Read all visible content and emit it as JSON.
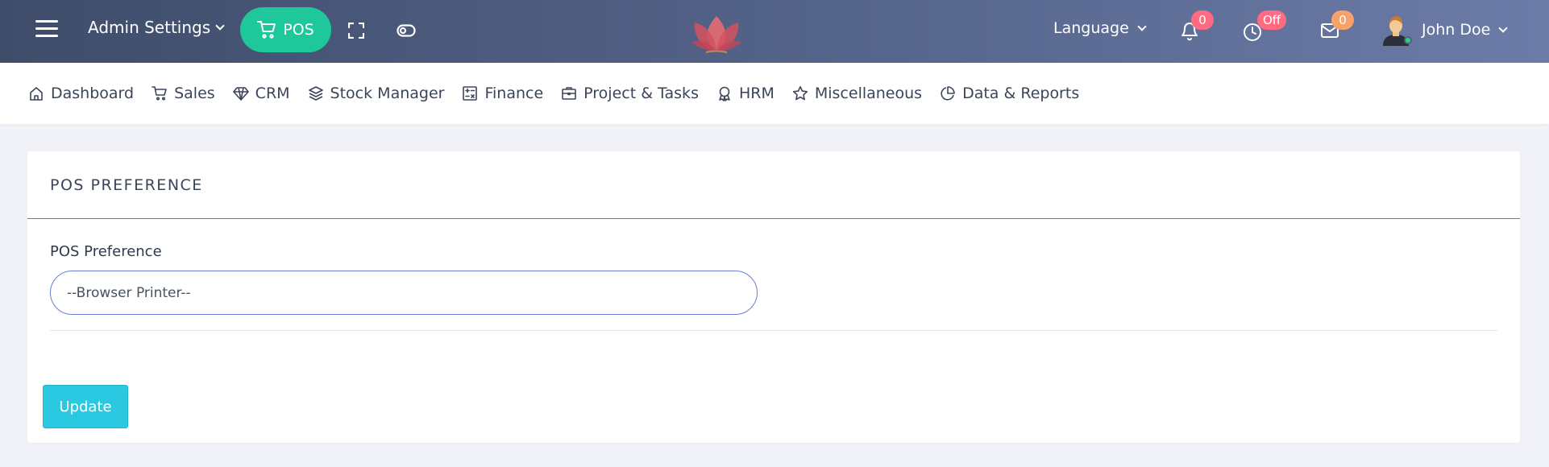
{
  "header": {
    "admin_settings": "Admin Settings",
    "pos_label": "POS",
    "language": "Language",
    "notifications_count": "0",
    "clock_status": "Off",
    "messages_count": "0",
    "user_name": "John Doe",
    "icons": [
      "menu-icon",
      "chevron-down-icon",
      "cart-icon",
      "fullscreen-icon",
      "toggle-icon",
      "lotus-logo",
      "bell-icon",
      "clock-icon",
      "mail-icon",
      "avatar"
    ],
    "colors": {
      "pos_button": "#1fc89a",
      "badge": "#ff6b81",
      "badge_messages": "#f7a26b"
    }
  },
  "nav": {
    "items": [
      {
        "label": "Dashboard",
        "icon": "home-icon"
      },
      {
        "label": "Sales",
        "icon": "cart-icon"
      },
      {
        "label": "CRM",
        "icon": "diamond-icon"
      },
      {
        "label": "Stock Manager",
        "icon": "layers-icon"
      },
      {
        "label": "Finance",
        "icon": "calculator-icon"
      },
      {
        "label": "Project & Tasks",
        "icon": "briefcase-icon"
      },
      {
        "label": "HRM",
        "icon": "award-icon"
      },
      {
        "label": "Miscellaneous",
        "icon": "star-icon"
      },
      {
        "label": "Data & Reports",
        "icon": "pie-chart-icon"
      }
    ]
  },
  "card": {
    "title": "POS PREFERENCE",
    "field_label": "POS Preference",
    "selected_value": "--Browser Printer--",
    "update_label": "Update"
  }
}
